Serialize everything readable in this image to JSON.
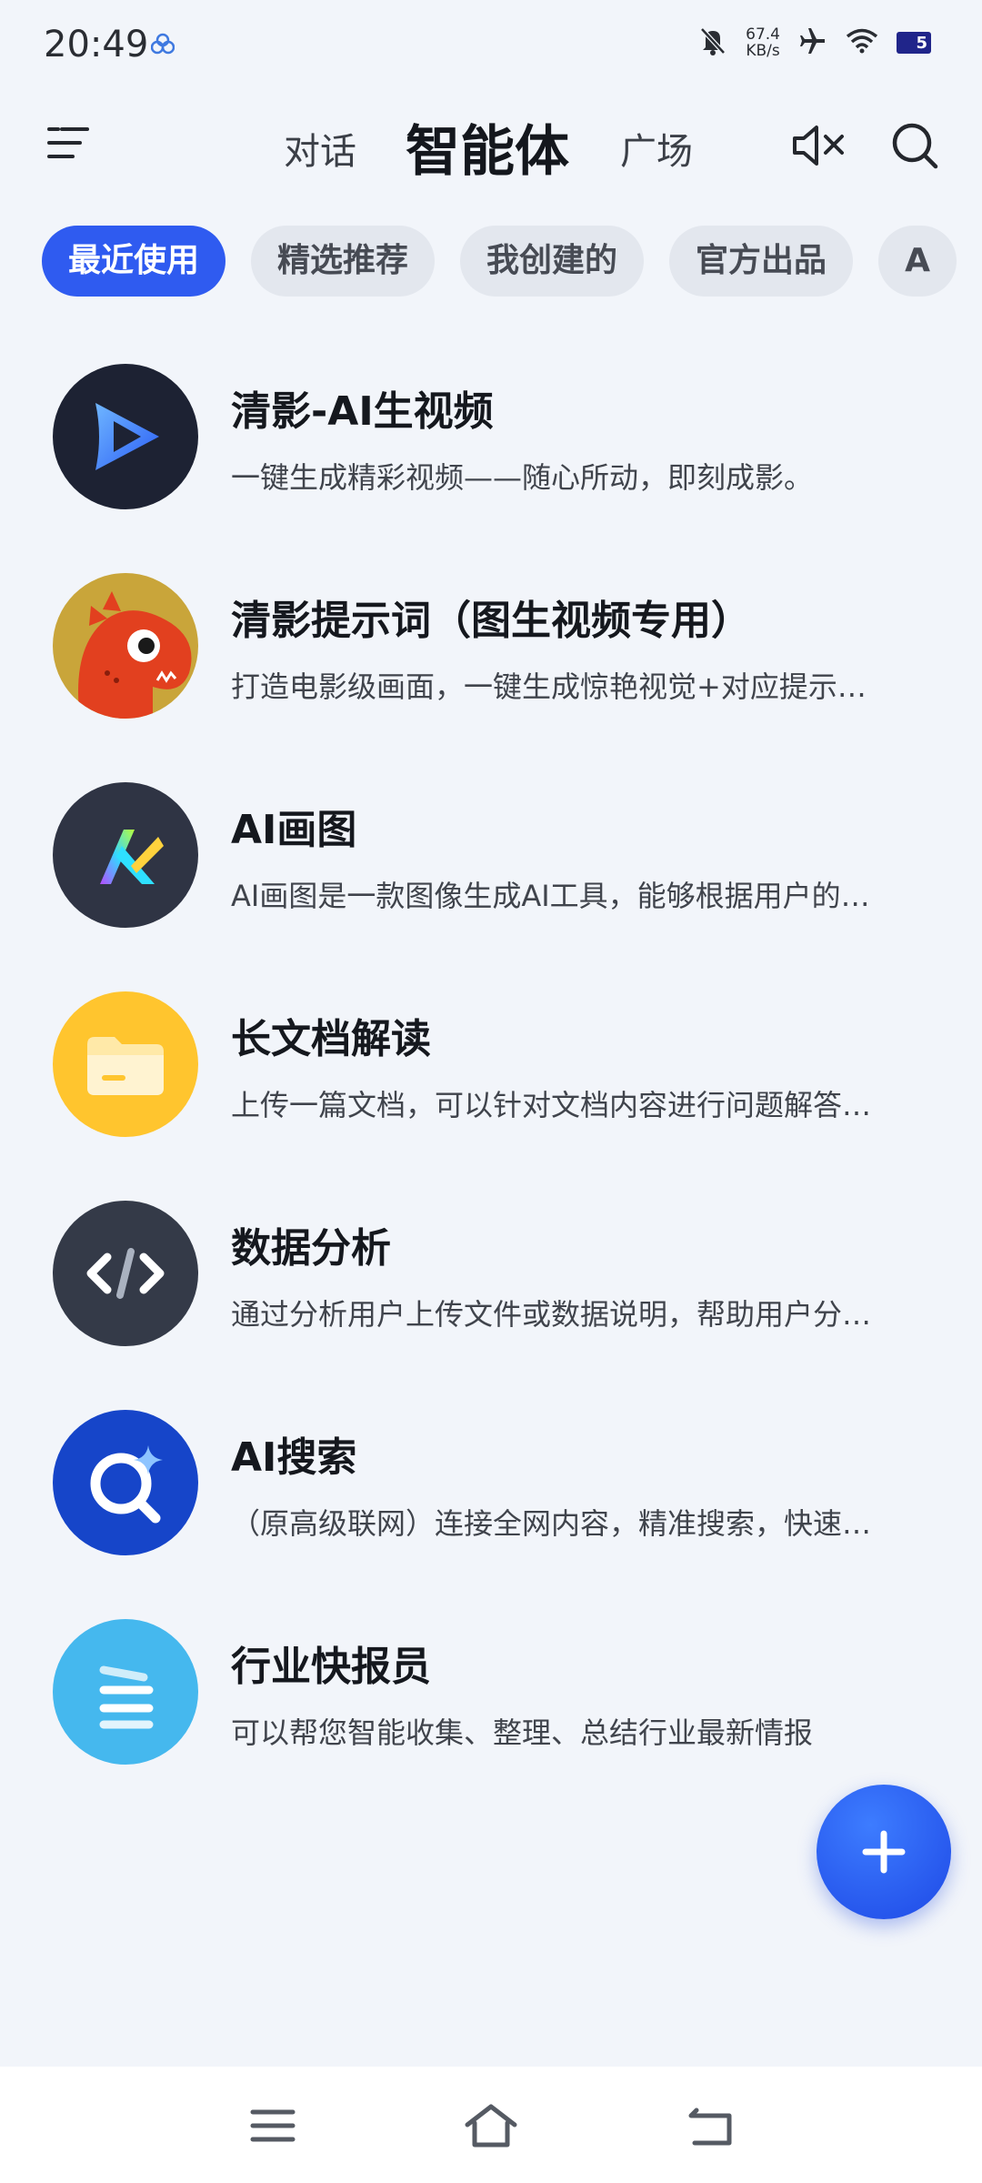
{
  "status": {
    "time": "20:49",
    "net_speed_value": "67.4",
    "net_speed_unit": "KB/s",
    "battery": "5"
  },
  "header": {
    "tabs": [
      {
        "label": "对话"
      },
      {
        "label": "智能体"
      },
      {
        "label": "广场"
      }
    ]
  },
  "filters": [
    {
      "label": "最近使用"
    },
    {
      "label": "精选推荐"
    },
    {
      "label": "我创建的"
    },
    {
      "label": "官方出品"
    },
    {
      "label": "A"
    }
  ],
  "agents": [
    {
      "title": "清影-AI生视频",
      "desc": "一键生成精彩视频——随心所动，即刻成影。",
      "icon": "play-video-icon"
    },
    {
      "title": "清影提示词（图生视频专用）",
      "desc": "打造电影级画面，一键生成惊艳视觉+对应提示…",
      "icon": "red-dinosaur-icon"
    },
    {
      "title": "AI画图",
      "desc": "AI画图是一款图像生成AI工具，能够根据用户的…",
      "icon": "ai-draw-icon"
    },
    {
      "title": "长文档解读",
      "desc": "上传一篇文档，可以针对文档内容进行问题解答…",
      "icon": "folder-icon"
    },
    {
      "title": "数据分析",
      "desc": "通过分析用户上传文件或数据说明，帮助用户分…",
      "icon": "code-icon"
    },
    {
      "title": "AI搜索",
      "desc": "（原高级联网）连接全网内容，精准搜索，快速…",
      "icon": "sparkle-search-icon"
    },
    {
      "title": "行业快报员",
      "desc": "可以帮您智能收集、整理、总结行业最新情报",
      "icon": "lines-icon"
    }
  ],
  "colors": {
    "accent": "#2f5bf0",
    "background": "#f2f5fa"
  }
}
